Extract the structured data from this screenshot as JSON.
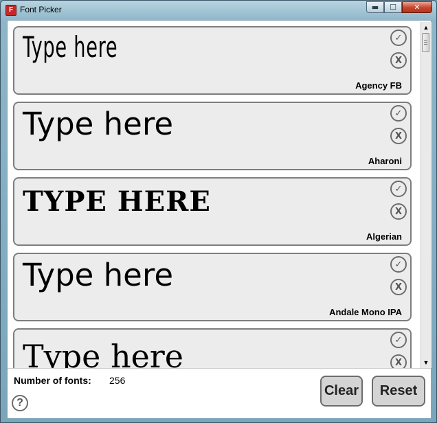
{
  "window": {
    "title": "Font Picker",
    "app_icon": "F"
  },
  "window_buttons": {
    "minimize": "▬",
    "maximize": "☐",
    "close": "✕"
  },
  "fonts": [
    {
      "sample": "Type here",
      "name": "Agency FB"
    },
    {
      "sample": "Type here",
      "name": "Aharoni"
    },
    {
      "sample": "TYPE HERE",
      "name": "Algerian"
    },
    {
      "sample": "Type here",
      "name": "Andale Mono IPA"
    },
    {
      "sample": "Type here",
      "name": ""
    }
  ],
  "card_buttons": {
    "select": "✓",
    "remove": "X"
  },
  "footer": {
    "count_label": "Number of fonts:",
    "count_value": "256",
    "help": "?",
    "clear_label": "Clear",
    "reset_label": "Reset"
  },
  "colors": {
    "accent_close": "#c4452c",
    "card_bg": "#ececec",
    "card_border": "#7d7d7d"
  }
}
